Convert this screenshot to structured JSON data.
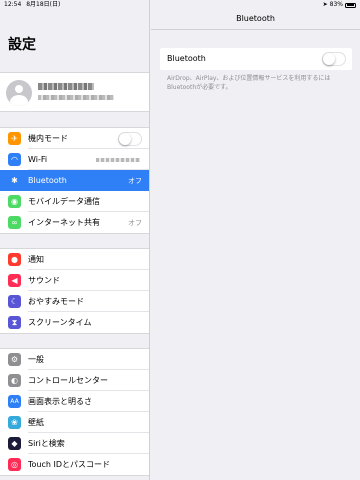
{
  "status_bar": {
    "time": "12:54",
    "date": "8月18日(日)",
    "battery": "83%",
    "battery_level": 0.83
  },
  "master": {
    "title": "設定",
    "groups": [
      {
        "items": [
          {
            "label": "機内モード",
            "icon": "airplane-icon",
            "color": "#ff9500",
            "glyph": "✈",
            "accessory": "toggle-off"
          },
          {
            "label": "Wi-Fi",
            "icon": "wifi-icon",
            "color": "#2f80f6",
            "glyph": "◠",
            "accessory": "blurred-network"
          },
          {
            "label": "Bluetooth",
            "icon": "bluetooth-icon",
            "color": "#2f80f6",
            "glyph": "✱",
            "value": "オフ",
            "selected": true
          },
          {
            "label": "モバイルデータ通信",
            "icon": "antenna-icon",
            "color": "#4cd964",
            "glyph": "◉"
          },
          {
            "label": "インターネット共有",
            "icon": "link-icon",
            "color": "#4cd964",
            "glyph": "∞",
            "value": "オフ"
          }
        ]
      },
      {
        "items": [
          {
            "label": "通知",
            "icon": "notifications-icon",
            "color": "#ff3b30",
            "glyph": "●"
          },
          {
            "label": "サウンド",
            "icon": "speaker-icon",
            "color": "#ff2d55",
            "glyph": "◀"
          },
          {
            "label": "おやすみモード",
            "icon": "moon-icon",
            "color": "#5856d6",
            "glyph": "☾"
          },
          {
            "label": "スクリーンタイム",
            "icon": "hourglass-icon",
            "color": "#5856d6",
            "glyph": "⧗"
          }
        ]
      },
      {
        "items": [
          {
            "label": "一般",
            "icon": "gear-icon",
            "color": "#8e8e93",
            "glyph": "⚙"
          },
          {
            "label": "コントロールセンター",
            "icon": "control-center-icon",
            "color": "#8e8e93",
            "glyph": "◐"
          },
          {
            "label": "画面表示と明るさ",
            "icon": "text-size-icon",
            "color": "#2f80f6",
            "glyph": "AA"
          },
          {
            "label": "壁紙",
            "icon": "wallpaper-icon",
            "color": "#34aadc",
            "glyph": "❀"
          },
          {
            "label": "Siriと検索",
            "icon": "siri-icon",
            "color": "#1c1c3a",
            "glyph": "◆"
          },
          {
            "label": "Touch IDとパスコード",
            "icon": "fingerprint-icon",
            "color": "#ff2d55",
            "glyph": "◎"
          }
        ]
      }
    ]
  },
  "detail": {
    "title": "Bluetooth",
    "bluetooth_label": "Bluetooth",
    "bluetooth_on": false,
    "footer": "AirDrop、AirPlay、および位置情報サービスを利用するにはBluetoothが必要です。"
  }
}
